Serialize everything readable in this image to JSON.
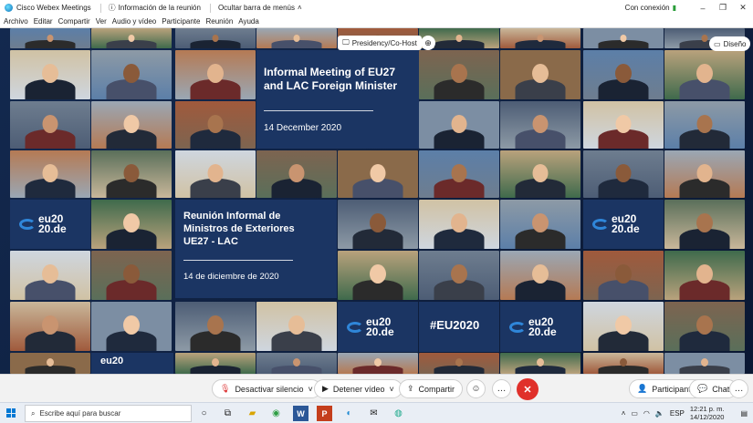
{
  "titlebar": {
    "app_name": "Cisco Webex Meetings",
    "meeting_info": "Información de la reunión",
    "hide_menu": "Ocultar barra de menús",
    "connection": "Con conexión"
  },
  "menu": [
    "Archivo",
    "Editar",
    "Compartir",
    "Ver",
    "Audio y vídeo",
    "Participante",
    "Reunión",
    "Ayuda"
  ],
  "video": {
    "host_chip": "Presidency/Co-Host",
    "layout_button": "Diseño",
    "panel_en": {
      "title_line1": "Informal Meeting of EU27",
      "title_line2": "and LAC Foreign Minister",
      "date": "14 December 2020"
    },
    "panel_es": {
      "title_line1": "Reunión Informal de",
      "title_line2": "Ministros de Exteriores",
      "title_line3": "UE27 - LAC",
      "date": "14 de diciembre de 2020"
    },
    "logo_line1": "eu20",
    "logo_line2": "20.de",
    "hashtag": "#EU2020"
  },
  "controls": {
    "mute": "Desactivar silencio",
    "stop_video": "Detener vídeo",
    "share": "Compartir",
    "participants": "Participantes",
    "chat": "Chat"
  },
  "taskbar": {
    "search_placeholder": "Escribe aquí para buscar",
    "language": "ESP",
    "time": "12:21 p. m.",
    "date": "14/12/2020"
  },
  "colors": {
    "panel_bg": "#1b3563",
    "end_call": "#e0302a",
    "accent": "#2f86d9"
  }
}
